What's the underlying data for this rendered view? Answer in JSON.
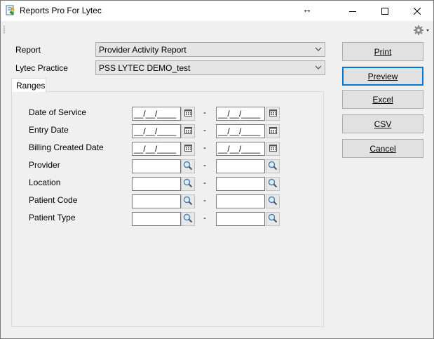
{
  "window": {
    "title": "Reports Pro For Lytec"
  },
  "form": {
    "report_label": "Report",
    "report_value": "Provider Activity Report",
    "practice_label": "Lytec Practice",
    "practice_value": "PSS LYTEC DEMO_test"
  },
  "tabs": [
    {
      "label": "Ranges"
    }
  ],
  "ranges": {
    "separator": "-",
    "date_placeholder": "__/__/____",
    "rows": [
      {
        "label": "Date of Service",
        "kind": "date",
        "from": "",
        "to": ""
      },
      {
        "label": "Entry Date",
        "kind": "date",
        "from": "",
        "to": ""
      },
      {
        "label": "Billing Created Date",
        "kind": "date",
        "from": "",
        "to": ""
      },
      {
        "label": "Provider",
        "kind": "lookup",
        "from": "",
        "to": ""
      },
      {
        "label": "Location",
        "kind": "lookup",
        "from": "",
        "to": ""
      },
      {
        "label": "Patient Code",
        "kind": "lookup",
        "from": "",
        "to": ""
      },
      {
        "label": "Patient Type",
        "kind": "lookup",
        "from": "",
        "to": ""
      }
    ]
  },
  "buttons": {
    "print": "Print",
    "preview": "Preview",
    "excel": "Excel",
    "csv": "CSV",
    "cancel": "Cancel"
  },
  "icons": {
    "app": "report-icon",
    "resize": "horizontal-resize-icon",
    "settings": "gear-icon",
    "calendar": "calendar-icon",
    "lookup": "magnifier-icon"
  },
  "colors": {
    "focus_border": "#0078d7",
    "titlebar": "#ffffff",
    "surface": "#f0f0f0"
  }
}
